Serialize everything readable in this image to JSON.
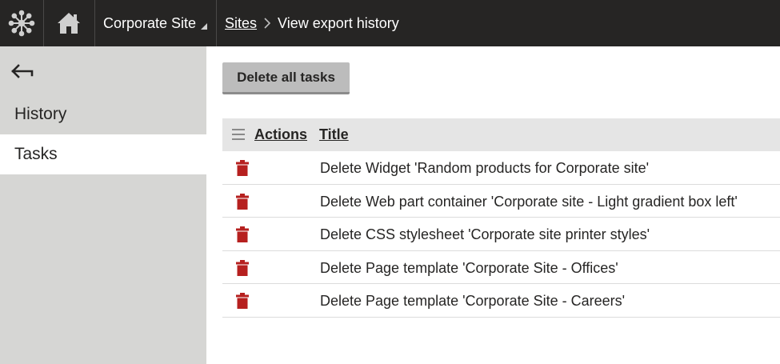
{
  "header": {
    "site_selector": "Corporate Site",
    "breadcrumb": {
      "link": "Sites",
      "current": "View export history"
    }
  },
  "sidebar": {
    "items": [
      {
        "label": "History"
      },
      {
        "label": "Tasks"
      }
    ]
  },
  "main": {
    "delete_all_label": "Delete all tasks",
    "table": {
      "columns": {
        "actions": "Actions",
        "title": "Title"
      },
      "rows": [
        {
          "title": "Delete Widget 'Random products for Corporate site'"
        },
        {
          "title": "Delete Web part container 'Corporate site - Light gradient box left'"
        },
        {
          "title": "Delete CSS stylesheet 'Corporate site printer styles'"
        },
        {
          "title": "Delete Page template 'Corporate Site - Offices'"
        },
        {
          "title": "Delete Page template 'Corporate Site - Careers'"
        }
      ]
    }
  },
  "icons": {
    "logo": "kentico-logo-icon",
    "home": "home-icon",
    "back": "back-arrow-icon",
    "grid_menu": "menu-icon",
    "delete": "trash-icon"
  },
  "colors": {
    "header_bg": "#262524",
    "sidebar_bg": "#d6d6d4",
    "delete_icon": "#b6201f",
    "table_header_bg": "#e5e5e5"
  }
}
